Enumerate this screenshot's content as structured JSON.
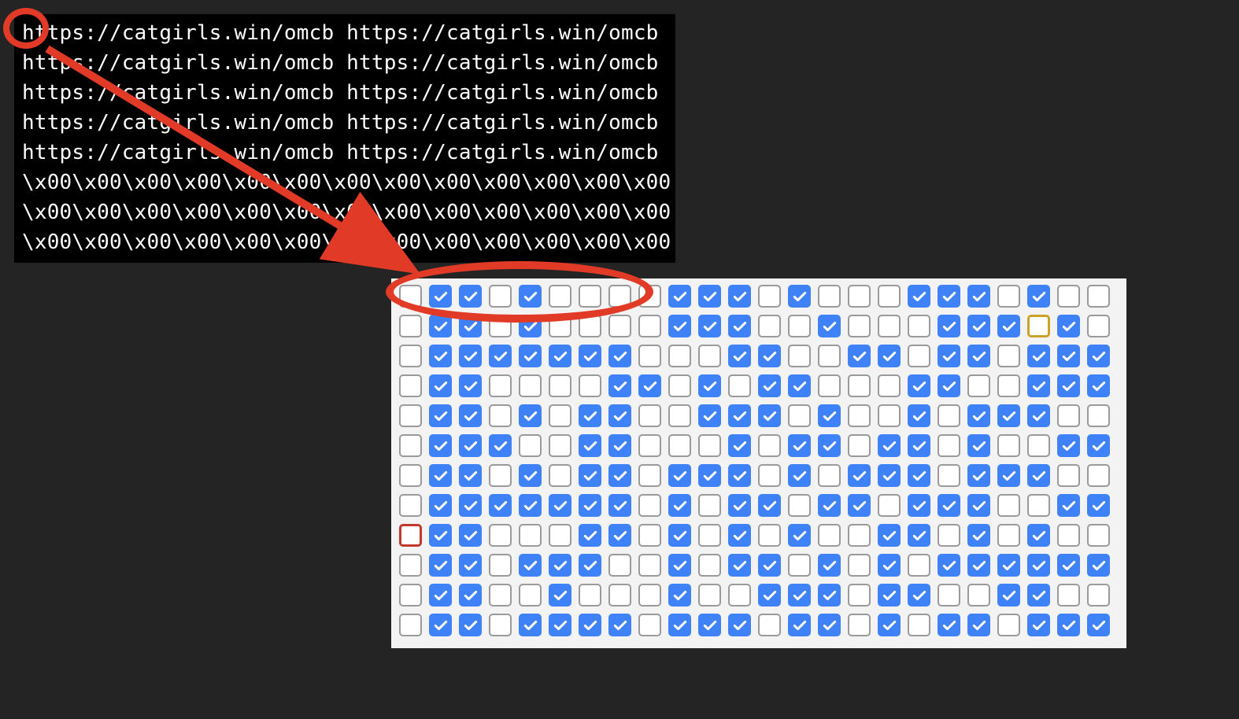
{
  "terminal": {
    "lines": [
      "https://catgirls.win/omcb https://catgirls.win/omcb",
      "https://catgirls.win/omcb https://catgirls.win/omcb",
      "https://catgirls.win/omcb https://catgirls.win/omcb",
      "https://catgirls.win/omcb https://catgirls.win/omcb",
      "https://catgirls.win/omcb https://catgirls.win/omcb",
      "\\x00\\x00\\x00\\x00\\x00\\x00\\x00\\x00\\x00\\x00\\x00\\x00\\x00",
      "\\x00\\x00\\x00\\x00\\x00\\x00\\x00\\x00\\x00\\x00\\x00\\x00\\x00",
      "\\x00\\x00\\x00\\x00\\x00\\x00\\x00\\x00\\x00\\x00\\x00\\x00\\x00"
    ]
  },
  "checkbox_grid": {
    "columns": 24,
    "rows": [
      [
        0,
        1,
        1,
        0,
        1,
        0,
        0,
        0,
        0,
        1,
        1,
        1,
        0,
        1,
        0,
        0,
        0,
        1,
        1,
        1,
        0,
        1,
        0,
        0
      ],
      [
        0,
        1,
        1,
        0,
        1,
        0,
        0,
        0,
        0,
        1,
        1,
        1,
        0,
        0,
        1,
        0,
        0,
        0,
        1,
        1,
        1,
        0,
        1,
        0
      ],
      [
        0,
        1,
        1,
        1,
        1,
        1,
        1,
        1,
        0,
        0,
        0,
        1,
        1,
        0,
        0,
        1,
        1,
        0,
        1,
        1,
        0,
        1,
        1,
        1
      ],
      [
        0,
        1,
        1,
        0,
        0,
        0,
        0,
        1,
        1,
        0,
        1,
        0,
        1,
        1,
        0,
        0,
        0,
        1,
        1,
        0,
        0,
        1,
        1,
        1
      ],
      [
        0,
        1,
        1,
        0,
        1,
        0,
        1,
        1,
        0,
        0,
        1,
        1,
        1,
        0,
        1,
        0,
        0,
        1,
        0,
        1,
        1,
        1,
        0,
        0
      ],
      [
        0,
        1,
        1,
        1,
        0,
        0,
        1,
        1,
        0,
        0,
        0,
        1,
        0,
        1,
        1,
        0,
        1,
        1,
        0,
        1,
        0,
        0,
        1,
        1
      ],
      [
        0,
        1,
        1,
        0,
        1,
        0,
        1,
        1,
        0,
        1,
        1,
        1,
        0,
        1,
        0,
        1,
        1,
        1,
        0,
        1,
        1,
        1,
        0,
        0
      ],
      [
        0,
        1,
        1,
        1,
        1,
        1,
        1,
        1,
        0,
        1,
        0,
        1,
        1,
        0,
        1,
        1,
        0,
        1,
        1,
        1,
        0,
        0,
        1,
        1
      ],
      [
        0,
        1,
        1,
        0,
        0,
        0,
        1,
        1,
        0,
        1,
        0,
        1,
        0,
        1,
        0,
        0,
        1,
        1,
        0,
        1,
        0,
        1,
        0,
        0
      ],
      [
        0,
        1,
        1,
        0,
        1,
        1,
        1,
        0,
        0,
        1,
        0,
        1,
        1,
        0,
        1,
        0,
        1,
        0,
        1,
        1,
        1,
        1,
        1,
        1
      ],
      [
        0,
        1,
        1,
        0,
        0,
        1,
        0,
        0,
        0,
        1,
        0,
        0,
        1,
        1,
        1,
        0,
        1,
        1,
        0,
        0,
        1,
        1,
        0,
        0
      ],
      [
        0,
        1,
        1,
        0,
        1,
        1,
        1,
        1,
        0,
        1,
        1,
        1,
        0,
        1,
        1,
        0,
        1,
        0,
        1,
        1,
        0,
        1,
        1,
        1
      ]
    ],
    "highlights": {
      "gold": [
        {
          "row": 1,
          "col": 21
        }
      ],
      "red": [
        {
          "row": 8,
          "col": 0
        }
      ]
    }
  },
  "colors": {
    "checkbox_blue": "#3f82f7",
    "annotation_red": "#e13b27",
    "highlight_gold": "#c9a227",
    "highlight_red": "#c0392b",
    "bg": "#242424"
  }
}
